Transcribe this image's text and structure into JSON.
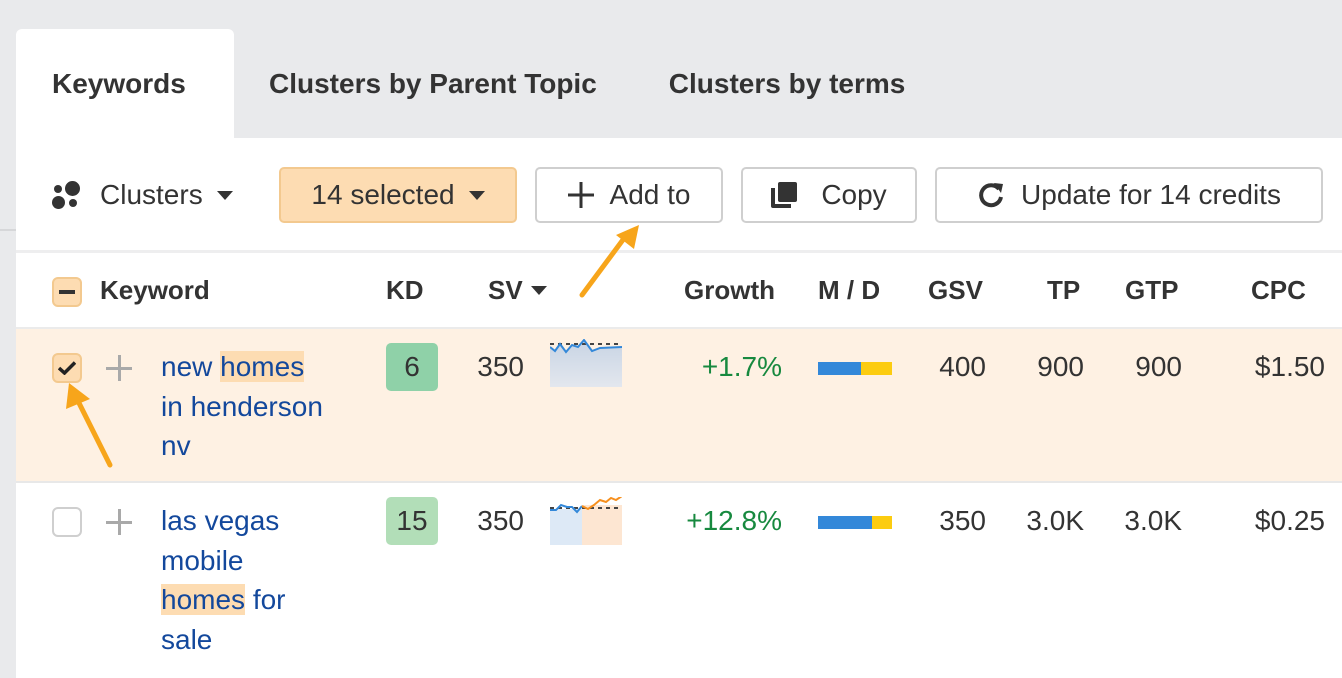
{
  "tabs": [
    {
      "label": "Keywords",
      "active": true
    },
    {
      "label": "Clusters by Parent Topic",
      "active": false
    },
    {
      "label": "Clusters by terms",
      "active": false
    }
  ],
  "toolbar": {
    "clusters_label": "Clusters",
    "selected_label": "14 selected",
    "add_to_label": "Add to",
    "copy_label": "Copy",
    "update_label": "Update for 14 credits"
  },
  "columns": {
    "keyword": "Keyword",
    "kd": "KD",
    "sv": "SV",
    "growth": "Growth",
    "md": "M / D",
    "gsv": "GSV",
    "tp": "TP",
    "gtp": "GTP",
    "cpc": "CPC"
  },
  "rows": [
    {
      "checked": true,
      "keyword_parts": [
        "new ",
        "homes",
        " in henderson nv"
      ],
      "keyword_lines": [
        [
          "new ",
          "homes"
        ],
        [
          "in henderson"
        ],
        [
          "nv"
        ]
      ],
      "kd": "6",
      "kd_color": "#8fd1a8",
      "sv": "350",
      "trend": "flat",
      "growth": "+1.7%",
      "md_mobile_fraction": 0.58,
      "gsv": "400",
      "tp": "900",
      "gtp": "900",
      "cpc": "$1.50"
    },
    {
      "checked": false,
      "keyword_lines": [
        [
          "las vegas"
        ],
        [
          "mobile"
        ],
        [
          "homes",
          " for"
        ],
        [
          "sale"
        ]
      ],
      "kd": "15",
      "kd_color": "#b2deb8",
      "sv": "350",
      "trend": "rising",
      "growth": "+12.8%",
      "md_mobile_fraction": 0.73,
      "gsv": "350",
      "tp": "3.0K",
      "gtp": "3.0K",
      "cpc": "$0.25"
    }
  ],
  "colors": {
    "accent_orange": "#f7a51b",
    "selected_bg": "#fddcb2",
    "row_highlight": "#fef1e3",
    "link": "#13489c",
    "growth_positive": "#17893f",
    "mobile_bar": "#3388d9",
    "desktop_bar": "#fccc10"
  }
}
